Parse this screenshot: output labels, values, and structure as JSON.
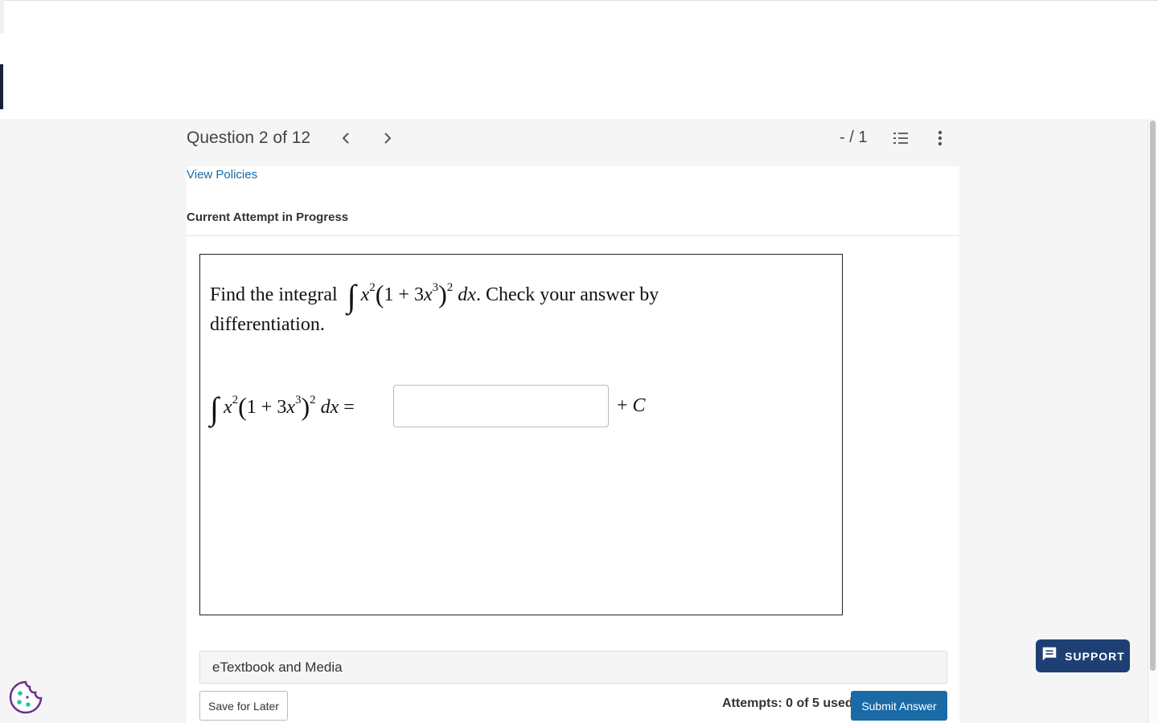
{
  "header": {
    "question_label": "Question 2 of 12",
    "score": "- / 1"
  },
  "panel": {
    "view_policies": "View Policies",
    "attempt_heading": "Current Attempt in Progress"
  },
  "question": {
    "prompt_before": "Find the integral",
    "prompt_after": ". Check your answer by",
    "prompt_line2": "differentiation.",
    "answer_value": "",
    "constant": "+ C"
  },
  "footer": {
    "etextbook_label": "eTextbook and Media",
    "save_label": "Save for Later",
    "attempts": "Attempts: 0 of 5 used",
    "submit_label": "Submit Answer"
  },
  "support": {
    "label": "SUPPORT"
  },
  "icons": {
    "prev": "chevron-left-icon",
    "next": "chevron-right-icon",
    "list": "numbered-list-icon",
    "more": "more-vertical-icon",
    "support": "chat-icon",
    "cookie": "cookie-icon"
  },
  "colors": {
    "link": "#1a6aa6",
    "primary_button": "#1a6aa6",
    "support_button": "#1d3f73",
    "cookie": "#6a2e8f",
    "cookie_dots": "#2ec4a0"
  }
}
